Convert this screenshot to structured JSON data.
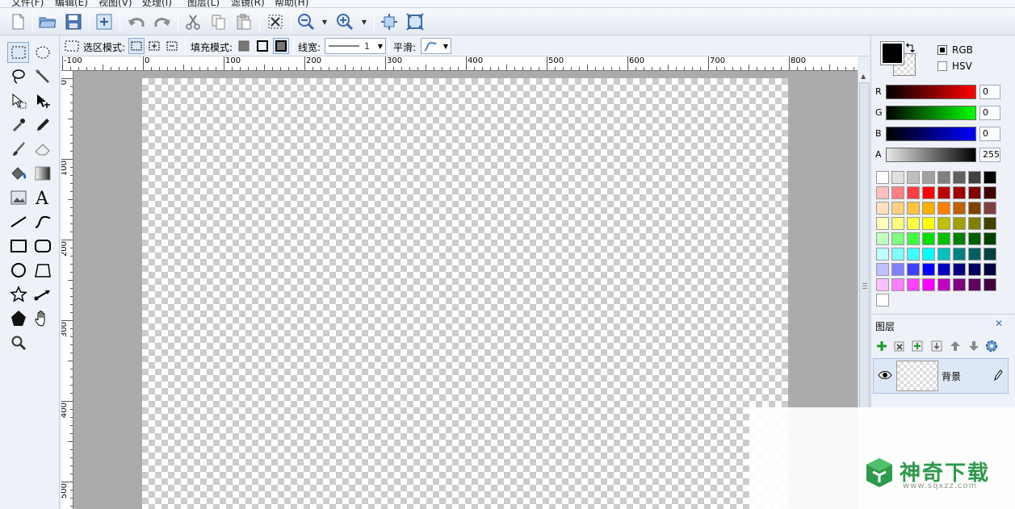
{
  "menu": [
    "文件(F)",
    "编辑(E)",
    "视图(V)",
    "处理(I)",
    "图层(L)",
    "滤镜(R)",
    "帮助(H)"
  ],
  "toolbar": {
    "buttons": [
      "new-file",
      "open",
      "save",
      "import",
      "undo",
      "redo",
      "cut",
      "copy",
      "paste",
      "deselect",
      "zoom-out",
      "zoom-in",
      "fit-window",
      "actual-size"
    ]
  },
  "options": {
    "select_mode_label": "选区模式:",
    "fill_mode_label": "填充模式:",
    "line_width_label": "线宽:",
    "line_width_value": "1",
    "smooth_label": "平滑:"
  },
  "rulers": {
    "horizontal": [
      "-100",
      "0",
      "100",
      "200",
      "300",
      "400",
      "500",
      "600",
      "700",
      "800"
    ],
    "vertical": [
      "0",
      "100",
      "200",
      "300",
      "400",
      "500"
    ]
  },
  "color": {
    "mode_rgb": "RGB",
    "mode_hsv": "HSV",
    "labels": [
      "R",
      "G",
      "B",
      "A"
    ],
    "values": [
      "0",
      "0",
      "0",
      "255"
    ],
    "primary": "#000000",
    "secondary": "#ffffff",
    "palette": [
      [
        "#ffffff",
        "#e0e0e0",
        "#c0c0c0",
        "#a0a0a0",
        "#808080",
        "#606060",
        "#404040",
        "#000000"
      ],
      [
        "#ffc0c0",
        "#ff8080",
        "#ff4040",
        "#ff0000",
        "#c00000",
        "#a00000",
        "#800000",
        "#400000"
      ],
      [
        "#ffe0c0",
        "#ffd080",
        "#ffc040",
        "#ffb000",
        "#ff8000",
        "#c06000",
        "#804000",
        "#804040"
      ],
      [
        "#ffffc0",
        "#ffff80",
        "#ffff40",
        "#ffff00",
        "#c0c000",
        "#a0a000",
        "#808000",
        "#404000"
      ],
      [
        "#c0ffc0",
        "#80ff80",
        "#40ff40",
        "#00e000",
        "#00c000",
        "#008000",
        "#006000",
        "#004000"
      ],
      [
        "#c0ffff",
        "#80ffff",
        "#40ffff",
        "#00ffff",
        "#00c0c0",
        "#008080",
        "#006060",
        "#004040"
      ],
      [
        "#c0c0ff",
        "#8080ff",
        "#4040ff",
        "#0000ff",
        "#0000c0",
        "#000080",
        "#000060",
        "#000040"
      ],
      [
        "#ffc0ff",
        "#ff80ff",
        "#ff40ff",
        "#ff00ff",
        "#c000c0",
        "#800080",
        "#600060",
        "#400040"
      ]
    ]
  },
  "layers": {
    "title": "图层",
    "items": [
      {
        "name": "背景"
      }
    ]
  },
  "watermark": {
    "text": "神奇下载",
    "url": "www.sqxzz.com",
    "brand_color": "#2e9a4a"
  }
}
